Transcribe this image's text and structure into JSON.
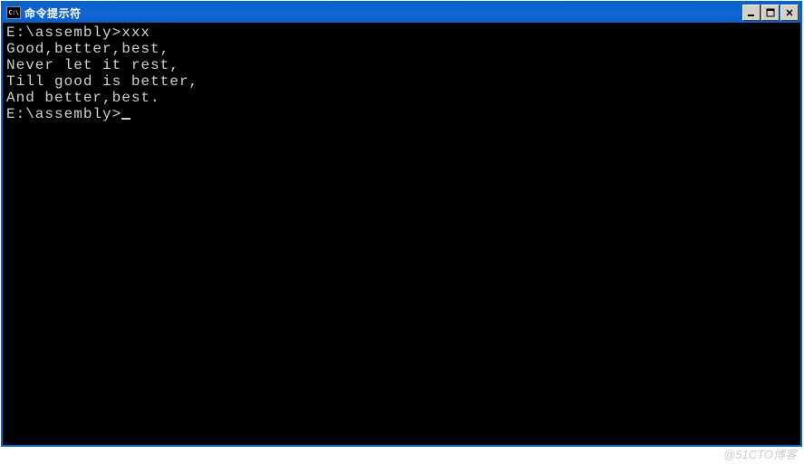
{
  "window": {
    "title": "命令提示符",
    "icon_label": "C:\\"
  },
  "controls": {
    "minimize": "minimize",
    "maximize": "maximize",
    "close": "close"
  },
  "terminal": {
    "lines": [
      "E:\\assembly>xxx",
      "Good,better,best,",
      "",
      "Never let it rest,",
      "",
      "Till good is better,",
      "",
      "And better,best.",
      "E:\\assembly>"
    ]
  },
  "watermark": "@51CTO博客"
}
